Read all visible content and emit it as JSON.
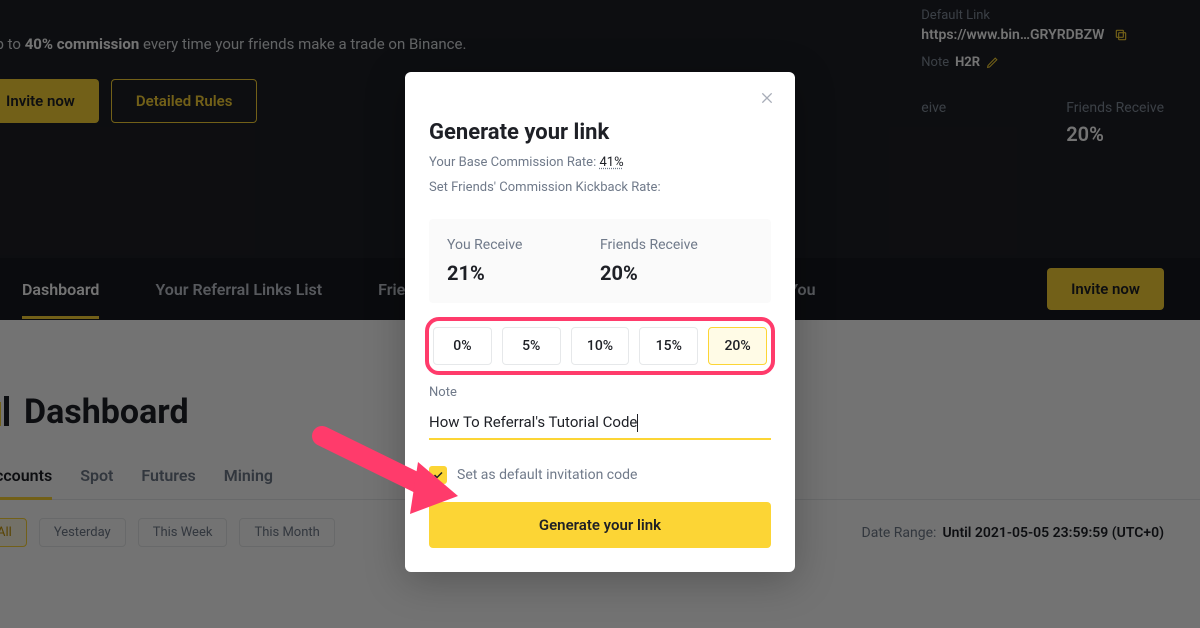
{
  "hero": {
    "tagline_prefix": "arn up to ",
    "tagline_bold": "40% commission",
    "tagline_suffix": " every time your friends make a trade on Binance.",
    "invite_button": "Invite now",
    "rules_button": "Detailed Rules"
  },
  "side": {
    "default_link_label": "Default Link",
    "default_link_value": "https://www.bin…GRYRDBZW",
    "note_prefix": "Note",
    "note_value": "H2R",
    "you_receive_label": "eive",
    "friends_receive_label": "Friends Receive",
    "friends_receive_value": "20%"
  },
  "tabs": {
    "items": [
      "Dashboard",
      "Your Referral Links List",
      "Friends",
      "s Shared With You"
    ],
    "active_index": 0,
    "invite_button": "Invite now"
  },
  "dashboard": {
    "title": "Dashboard",
    "sub_tabs": [
      "ll Accounts",
      "Spot",
      "Futures",
      "Mining"
    ],
    "sub_active_index": 0,
    "filters": [
      "All",
      "Yesterday",
      "This Week",
      "This Month"
    ],
    "filter_active_index": 0,
    "date_range_label": "Date Range:",
    "date_range_value": "Until 2021-05-05 23:59:59 (UTC+0)"
  },
  "modal": {
    "title": "Generate your link",
    "base_rate_label": "Your Base Commission Rate:",
    "base_rate_value": "41%",
    "kickback_label": "Set Friends' Commission Kickback Rate:",
    "you_receive_label": "You Receive",
    "you_receive_value": "21%",
    "friends_receive_label": "Friends Receive",
    "friends_receive_value": "20%",
    "pct_options": [
      "0%",
      "5%",
      "10%",
      "15%",
      "20%"
    ],
    "pct_selected_index": 4,
    "note_label": "Note",
    "note_value": "How To Referral's Tutorial Code",
    "default_checkbox_label": "Set as default invitation code",
    "generate_button": "Generate your link"
  }
}
